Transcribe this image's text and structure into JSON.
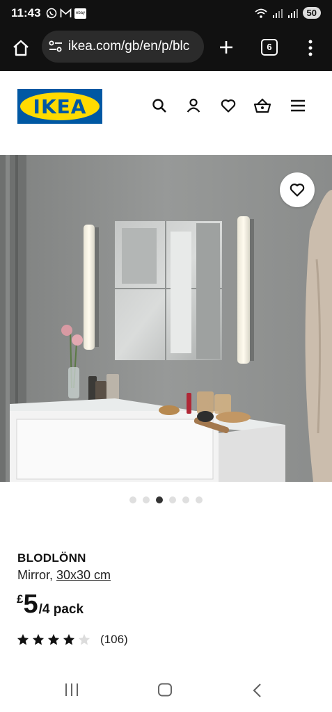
{
  "status_bar": {
    "time": "11:43",
    "ebay_label": "ebay",
    "battery": "50"
  },
  "browser": {
    "url": "ikea.com/gb/en/p/blc",
    "tab_count": "6"
  },
  "header": {
    "logo_text": "IKEA",
    "icons": [
      "search-icon",
      "account-icon",
      "heart-icon",
      "basket-icon",
      "menu-icon"
    ]
  },
  "gallery": {
    "total_images": 6,
    "active_index": 2
  },
  "product": {
    "name": "BLODLÖNN",
    "description_prefix": "Mirror, ",
    "size_link": "30x30 cm",
    "currency": "£",
    "price": "5",
    "price_unit": "/4 pack",
    "rating_value": 4,
    "rating_max": 5,
    "review_count": "(106)"
  },
  "colors": {
    "ikea_blue": "#0058a3",
    "ikea_yellow": "#ffdb00"
  }
}
